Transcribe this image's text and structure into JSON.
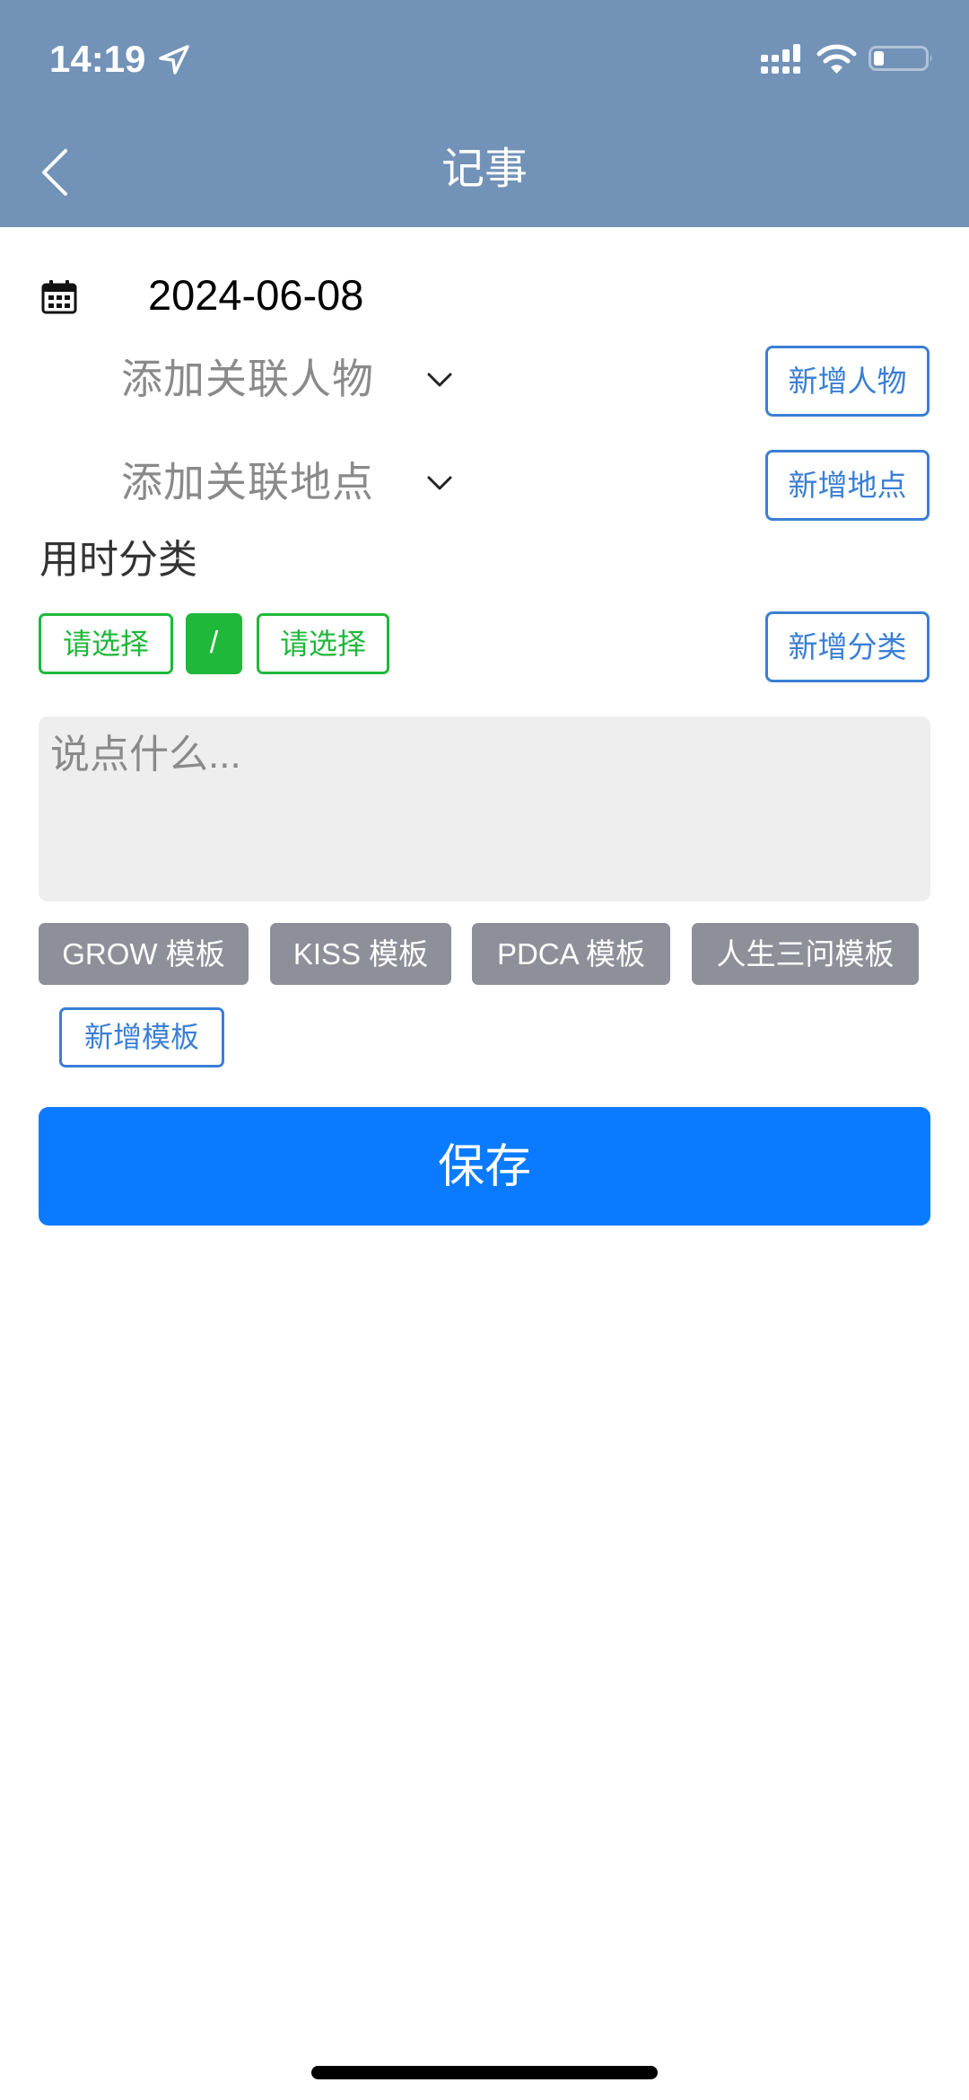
{
  "status_bar": {
    "time": "14:19",
    "battery_level": 0.2,
    "icons": [
      "location-arrow-icon",
      "cellular-signal-icon",
      "wifi-icon",
      "battery-icon"
    ]
  },
  "header": {
    "title": "记事",
    "back_icon": "chevron-left-icon"
  },
  "colors": {
    "header_bg": "#7292b7",
    "accent_blue": "#3a7fd5",
    "accent_green": "#1fb83a",
    "save_blue": "#0a7bff",
    "template_gray": "#8e9099"
  },
  "form": {
    "date": "2024-06-08",
    "person_dropdown": {
      "placeholder": "添加关联人物",
      "value": ""
    },
    "add_person_label": "新增人物",
    "location_dropdown": {
      "placeholder": "添加关联地点",
      "value": ""
    },
    "add_location_label": "新增地点",
    "category_section_label": "用时分类",
    "category_primary": "请选择",
    "category_separator": "/",
    "category_secondary": "请选择",
    "add_category_label": "新增分类",
    "note": {
      "placeholder": "说点什么...",
      "value": ""
    },
    "templates": [
      {
        "label": "GROW 模板"
      },
      {
        "label": "KISS 模板"
      },
      {
        "label": "PDCA 模板"
      },
      {
        "label": "人生三问模板"
      }
    ],
    "add_template_label": "新增模板",
    "save_label": "保存"
  }
}
